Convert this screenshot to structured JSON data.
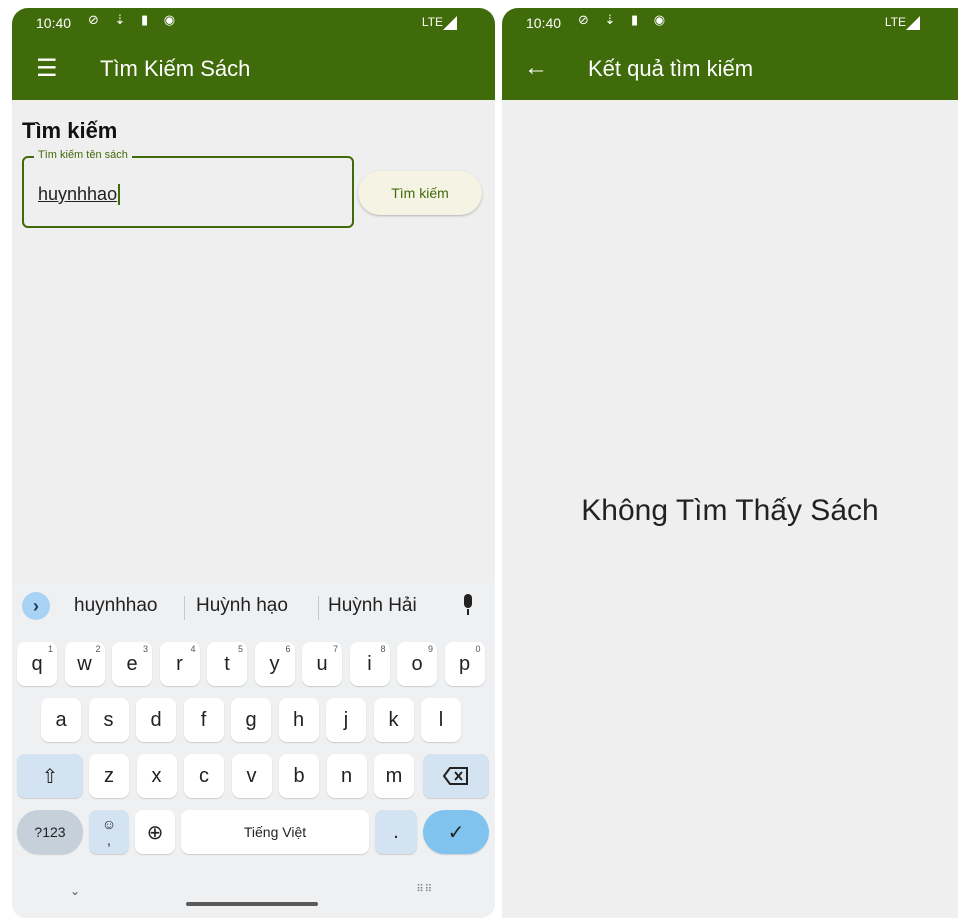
{
  "left_screen": {
    "status": {
      "time": "10:40",
      "icons": "⊘ ⇣ ▮ ◉",
      "network": "LTE"
    },
    "appbar": {
      "menu_icon": "menu-icon",
      "title": "Tìm Kiếm Sách"
    },
    "form": {
      "heading": "Tìm kiếm",
      "field_label": "Tìm kiếm tên sách",
      "field_value": "huynhhao",
      "button_label": "Tìm kiếm"
    },
    "keyboard": {
      "suggestions": [
        "huynhhao",
        "Huỳnh hạo",
        "Huỳnh Hải"
      ],
      "row1": [
        {
          "k": "q",
          "n": "1"
        },
        {
          "k": "w",
          "n": "2"
        },
        {
          "k": "e",
          "n": "3"
        },
        {
          "k": "r",
          "n": "4"
        },
        {
          "k": "t",
          "n": "5"
        },
        {
          "k": "y",
          "n": "6"
        },
        {
          "k": "u",
          "n": "7"
        },
        {
          "k": "i",
          "n": "8"
        },
        {
          "k": "o",
          "n": "9"
        },
        {
          "k": "p",
          "n": "0"
        }
      ],
      "row2": [
        "a",
        "s",
        "d",
        "f",
        "g",
        "h",
        "j",
        "k",
        "l"
      ],
      "row3": [
        "z",
        "x",
        "c",
        "v",
        "b",
        "n",
        "m"
      ],
      "numbers_label": "?123",
      "emoji_label": "☺",
      "comma_label": ",",
      "space_label": "Tiếng Việt",
      "period_label": ".",
      "shift_glyph": "⇧",
      "enter_glyph": "✓",
      "globe_glyph": "⊕",
      "hide_glyph": "⌄",
      "switch_glyph": "⠿⠿"
    }
  },
  "right_screen": {
    "status": {
      "time": "10:40",
      "icons": "⊘ ⇣ ▮ ◉",
      "network": "LTE"
    },
    "appbar": {
      "back_icon": "back-arrow-icon",
      "title": "Kết quả tìm kiếm"
    },
    "empty_message": "Không Tìm Thấy Sách"
  },
  "colors": {
    "appbar": "#3f6b0a",
    "background": "#efefef",
    "accent_key": "#7fc3ee"
  }
}
